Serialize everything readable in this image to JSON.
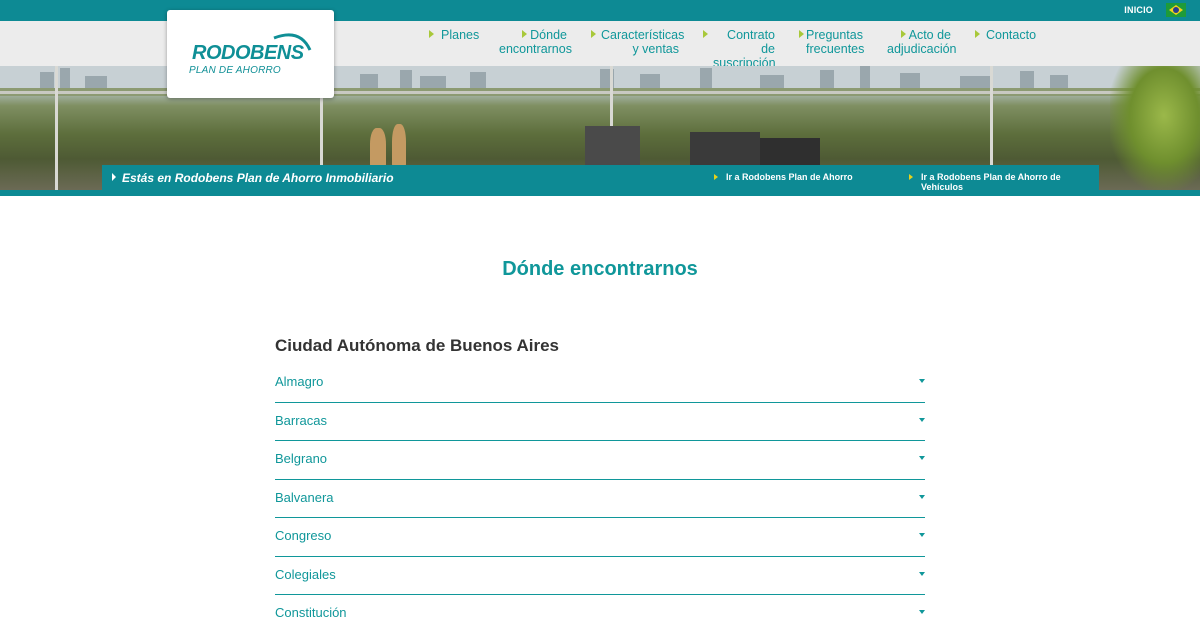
{
  "topbar": {
    "inicio": "INICIO",
    "language_flag": "brazil-flag-icon"
  },
  "logo": {
    "brand": "RODOBENS",
    "subtitle": "PLAN DE AHORRO"
  },
  "nav": [
    {
      "label_line1": "Planes",
      "label_line2": ""
    },
    {
      "label_line1": "Dónde",
      "label_line2": "encontrarnos"
    },
    {
      "label_line1": "Características",
      "label_line2": "y ventas"
    },
    {
      "label_line1": "Contrato de",
      "label_line2": "suscripción"
    },
    {
      "label_line1": "Preguntas",
      "label_line2": "frecuentes"
    },
    {
      "label_line1": "Acto de",
      "label_line2": "adjudicación"
    },
    {
      "label_line1": "Contacto",
      "label_line2": ""
    }
  ],
  "breadcrumb": {
    "current": "Estás en Rodobens Plan de Ahorro Inmobiliario",
    "link1": "Ir a Rodobens Plan de Ahorro",
    "link2": "Ir a Rodobens Plan de Ahorro de Vehículos"
  },
  "main": {
    "title": "Dónde encontrarnos",
    "region": "Ciudad Autónoma de Buenos Aires",
    "locations": [
      "Almagro",
      "Barracas",
      "Belgrano",
      "Balvanera",
      "Congreso",
      "Colegiales",
      "Constitución"
    ]
  },
  "colors": {
    "teal": "#0d8a94",
    "link": "#10979a",
    "nav_arrow": "#a8c83a",
    "nav_bg": "#ececec"
  }
}
